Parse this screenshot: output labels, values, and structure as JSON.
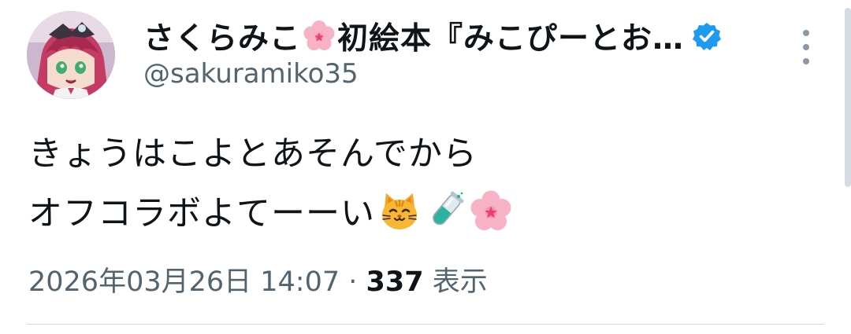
{
  "author": {
    "display_name": "さくらみこ",
    "display_name_rest": "初絵本『みこぴーとお…",
    "name_emoji": "cherry-blossom-emoji",
    "handle": "@sakuramiko35",
    "verified_badge": "verified-badge-icon"
  },
  "tweet": {
    "line1": "きょうはこよとあそんでから",
    "line2": "オフコラボよてーーい",
    "emojis": [
      "cat-face-emoji",
      "test-tube-emoji",
      "cherry-blossom-emoji"
    ]
  },
  "meta": {
    "timestamp": "2026年03月26日 14:07",
    "separator": " · ",
    "views_count": "337",
    "views_label": " 表示"
  },
  "colors": {
    "text_primary": "#0f1419",
    "text_secondary": "#536471",
    "verified_blue": "#1d9bf0",
    "divider": "#cfd9de"
  }
}
